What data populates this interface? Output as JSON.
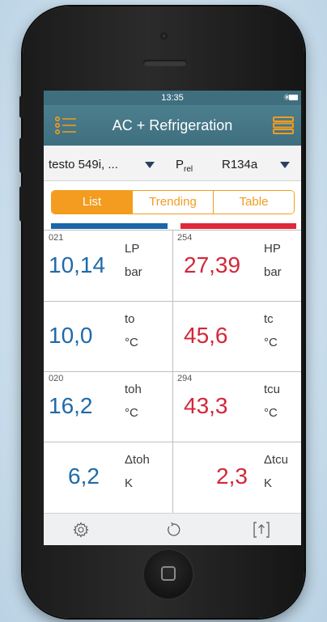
{
  "status_bar": {
    "time": "13:35",
    "bluetooth_icon": "bluetooth-icon",
    "battery_icon": "battery-icon"
  },
  "nav": {
    "title": "AC + Refrigeration",
    "left_icon": "list-icon",
    "right_icon": "menu-icon"
  },
  "device_bar": {
    "device": "testo 549i, ...",
    "pressure_mode_main": "P",
    "pressure_mode_sub": "rel",
    "refrigerant": "R134a"
  },
  "tabs": [
    {
      "label": "List",
      "active": true
    },
    {
      "label": "Trending",
      "active": false
    },
    {
      "label": "Table",
      "active": false
    }
  ],
  "measurements": {
    "lp": {
      "id": "021",
      "value": "10,14",
      "name": "LP",
      "unit": "bar"
    },
    "hp": {
      "id": "254",
      "value": "27,39",
      "name": "HP",
      "unit": "bar"
    },
    "to": {
      "id": "",
      "value": "10,0",
      "name": "to",
      "unit": "°C"
    },
    "tc": {
      "id": "",
      "value": "45,6",
      "name": "tc",
      "unit": "°C"
    },
    "toh": {
      "id": "020",
      "value": "16,2",
      "name": "toh",
      "unit": "°C"
    },
    "tcu": {
      "id": "294",
      "value": "43,3",
      "name": "tcu",
      "unit": "°C"
    },
    "dtoh": {
      "id": "",
      "value": "6,2",
      "name": "Δtoh",
      "unit": "K"
    },
    "dtcu": {
      "id": "",
      "value": "2,3",
      "name": "Δtcu",
      "unit": "K"
    }
  },
  "toolbar": {
    "settings_icon": "gear-icon",
    "reset_icon": "reset-icon",
    "share_icon": "share-icon"
  },
  "colors": {
    "header": "#3f6f7f",
    "accent": "#f39c1f",
    "low_pressure": "#1a66a8",
    "high_pressure": "#e0283a"
  }
}
